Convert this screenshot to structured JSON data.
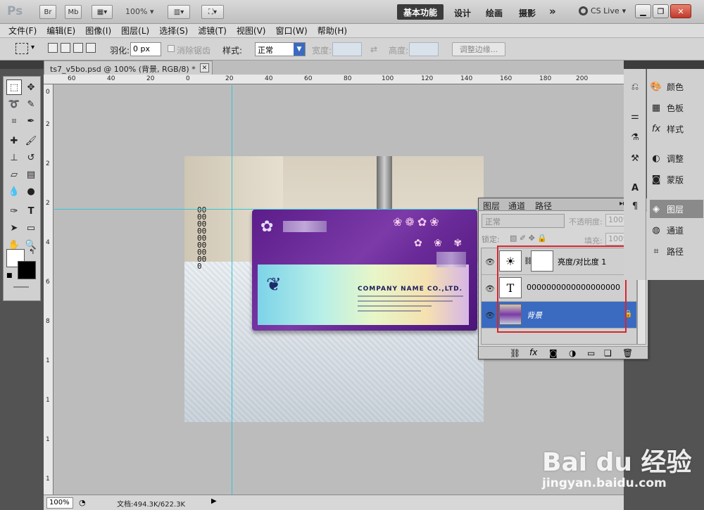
{
  "appbar": {
    "logo": "Ps",
    "br": "Br",
    "mb": "Mb",
    "zoom": "100%",
    "workspaces": [
      "基本功能",
      "设计",
      "绘画",
      "摄影"
    ],
    "more": "»",
    "cslive": "CS Live"
  },
  "menu": [
    "文件(F)",
    "编辑(E)",
    "图像(I)",
    "图层(L)",
    "选择(S)",
    "滤镜(T)",
    "视图(V)",
    "窗口(W)",
    "帮助(H)"
  ],
  "options": {
    "feather_label": "羽化:",
    "feather_value": "0 px",
    "antialias": "消除锯齿",
    "style_label": "样式:",
    "style_value": "正常",
    "width_label": "宽度:",
    "height_label": "高度:",
    "refine_edge": "调整边缘..."
  },
  "document": {
    "tab_title": "ts7_v5bo.psd @ 100% (背景, RGB/8) *",
    "ruler_top": [
      "60",
      "40",
      "20",
      "0",
      "20",
      "40",
      "60",
      "80",
      "100",
      "120",
      "140",
      "160",
      "180",
      "200"
    ],
    "ruler_left": [
      "0",
      "2",
      "4",
      "6",
      "8",
      "1",
      "1",
      "1",
      "1"
    ],
    "status_zoom": "100%",
    "status_doc": "文档:494.3K/622.3K"
  },
  "card": {
    "company": "COMPANY NAME CO.,LTD.",
    "vertical_text": "00000000000000000"
  },
  "layers_panel": {
    "tabs": [
      "图层",
      "通道",
      "路径"
    ],
    "blend_mode": "正常",
    "opacity_label": "不透明度:",
    "opacity_value": "100%",
    "lock_label": "锁定:",
    "fill_label": "填充:",
    "fill_value": "100%",
    "layers": [
      {
        "name": "亮度/对比度 1",
        "type": "adjustment",
        "selected": false
      },
      {
        "name": "0000000000000000000",
        "type": "text",
        "selected": false
      },
      {
        "name": "背景",
        "type": "background",
        "selected": true
      }
    ]
  },
  "right_panels": [
    "颜色",
    "色板",
    "样式",
    "调整",
    "蒙版",
    "图层",
    "通道",
    "路径"
  ],
  "watermark": {
    "brand": "Bai du 经验",
    "url": "jingyan.baidu.com"
  },
  "colors": {
    "accent": "#3a6bc1",
    "guide": "#33c6d6",
    "highlight_box": "#d9262e"
  }
}
